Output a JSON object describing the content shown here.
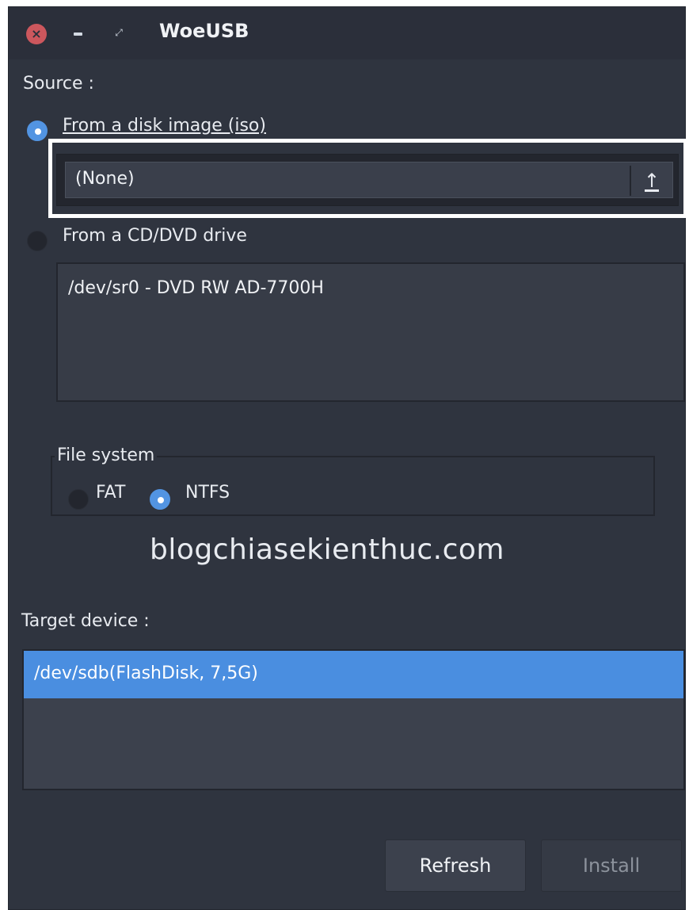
{
  "window": {
    "title": "WoeUSB"
  },
  "source": {
    "label": "Source :",
    "iso_option": "From a disk image (iso)",
    "iso_selected": true,
    "iso_path": "(None)",
    "cd_option": "From a CD/DVD drive",
    "cd_selected": false,
    "cd_drives": [
      "/dev/sr0 - DVD RW AD-7700H"
    ]
  },
  "filesystem": {
    "label": "File system",
    "options": [
      "FAT",
      "NTFS"
    ],
    "selected": "NTFS"
  },
  "watermark": "blogchiasekienthuc.com",
  "target": {
    "label": "Target device :",
    "devices": [
      "/dev/sdb(FlashDisk, 7,5G)"
    ],
    "selected_index": 0
  },
  "buttons": {
    "refresh": "Refresh",
    "install": "Install"
  },
  "colors": {
    "accent": "#5294e2",
    "selection": "#4a8ee0",
    "background": "#2f343f",
    "close": "#cc575d",
    "highlight_box": "#ffffff"
  }
}
